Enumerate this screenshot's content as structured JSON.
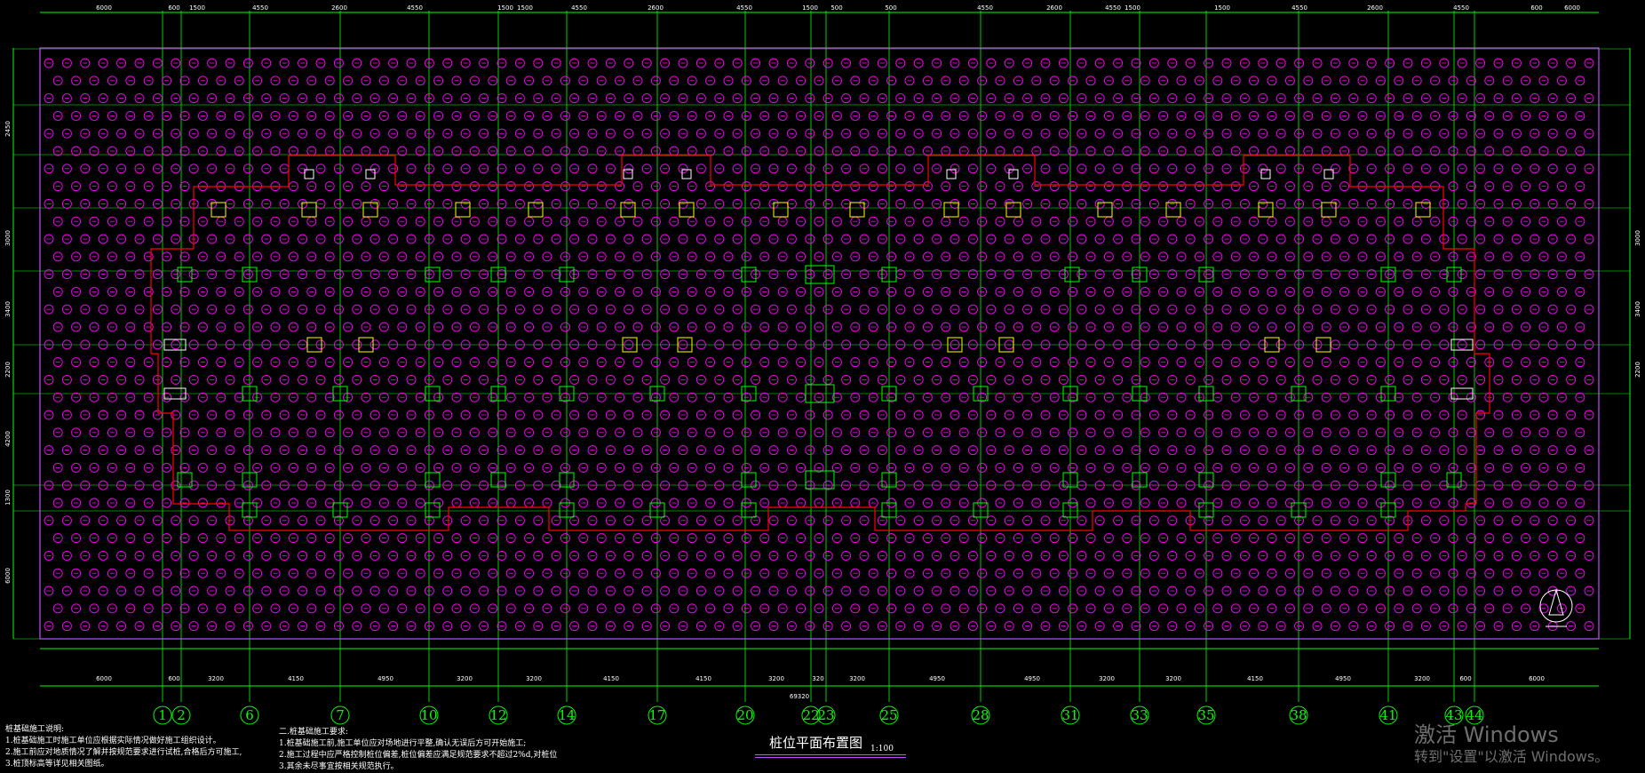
{
  "drawing": {
    "title": "桩位平面布置图",
    "scale": "1:100",
    "colors": {
      "background": "#000000",
      "pile": "#ff00ff",
      "axis": "#00ff00",
      "boundary": "#ff0000",
      "outline": "#c050ff",
      "pilecap": "#ffff00",
      "text": "#ffffff"
    },
    "top_dimensions": [
      "6000",
      "600",
      "1500",
      "4550",
      "2600",
      "4550",
      "1500",
      "1500",
      "4550",
      "2600",
      "4550",
      "1500",
      "500",
      "500",
      "4550",
      "2600",
      "4550",
      "1500",
      "1500",
      "4550",
      "2600",
      "4550",
      "600",
      "6000"
    ],
    "bottom_dimensions": [
      "6000",
      "600",
      "3200",
      "4150",
      "4950",
      "3200",
      "3200",
      "4150",
      "4150",
      "3200",
      "320",
      "3200",
      "4950",
      "4950",
      "3200",
      "3200",
      "4150",
      "4950",
      "3200",
      "600",
      "6000"
    ],
    "bottom_total": "69320",
    "left_dimensions": [
      "2450",
      "3000",
      "3400",
      "2200",
      "4200",
      "1300",
      "6000"
    ],
    "right_dimensions": [
      "3000",
      "3400",
      "2200"
    ],
    "axes": [
      "1",
      "2",
      "6",
      "7",
      "10",
      "12",
      "14",
      "17",
      "20",
      "22",
      "23",
      "25",
      "28",
      "31",
      "33",
      "35",
      "38",
      "41",
      "43",
      "44"
    ]
  },
  "notes": {
    "left_heading": "桩基础施工说明:",
    "left_lines": [
      "1.桩基础施工时施工单位应根据实际情况做好施工组织设计。",
      "2.施工前应对地质情况了解并按规范要求进行试桩,合格后方可施工,",
      "3.桩顶标高等详见相关图纸。"
    ],
    "right_heading": "二.桩基础施工要求:",
    "right_lines": [
      "1.桩基础施工前,施工单位应对场地进行平整,确认无误后方可开始施工;",
      "2.施工过程中应严格控制桩位偏差,桩位偏差应满足规范要求不超过2%d,对桩位",
      "3.其余未尽事宜按相关规范执行。"
    ]
  },
  "watermark": {
    "line1": "激活 Windows",
    "line2": "转到\"设置\"以激活 Windows。"
  }
}
